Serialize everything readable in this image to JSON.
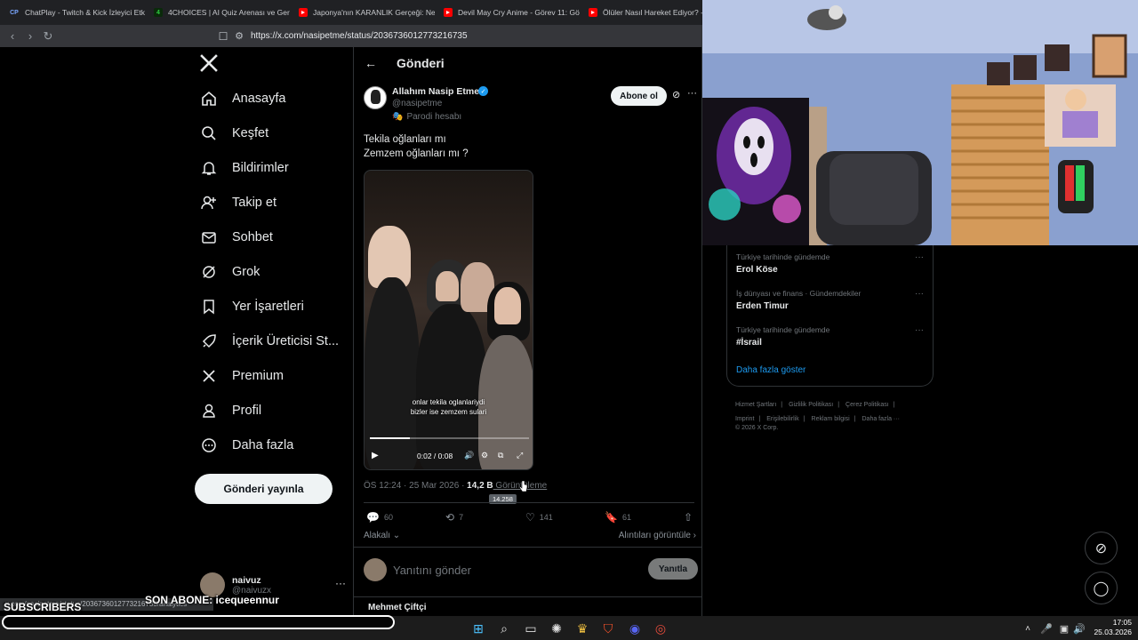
{
  "browser": {
    "tabs": [
      {
        "title": "ChatPlay - Twitch & Kick İzleyici Etkil",
        "favicon": "chatplay-icon"
      },
      {
        "title": "4CHOICES | AI Quiz Arenası ve Gerçe",
        "favicon": "4choices-icon"
      },
      {
        "title": "Japonya'nın KARANLIK Gerçeği: Nedi",
        "favicon": "youtube-icon"
      },
      {
        "title": "Devil May Cry Anime - Görev 11: Gö",
        "favicon": "youtube-icon"
      },
      {
        "title": "Ölüler Nasıl Hareket Ediyor? - Y",
        "favicon": "youtube-icon"
      }
    ],
    "url": "https://x.com/nasipetme/status/2036736012773216735"
  },
  "nav": {
    "items": [
      {
        "label": "Anasayfa",
        "icon": "home-icon"
      },
      {
        "label": "Keşfet",
        "icon": "search-icon"
      },
      {
        "label": "Bildirimler",
        "icon": "bell-icon"
      },
      {
        "label": "Takip et",
        "icon": "person-add-icon"
      },
      {
        "label": "Sohbet",
        "icon": "mail-icon"
      },
      {
        "label": "Grok",
        "icon": "grok-icon"
      },
      {
        "label": "Yer İşaretleri",
        "icon": "bookmark-icon"
      },
      {
        "label": "İçerik Üreticisi St...",
        "icon": "rocket-icon"
      },
      {
        "label": "Premium",
        "icon": "x-icon"
      },
      {
        "label": "Profil",
        "icon": "person-icon"
      },
      {
        "label": "Daha fazla",
        "icon": "more-circle-icon"
      }
    ],
    "post_button": "Gönderi yayınla",
    "user": {
      "name": "naivuz",
      "handle": "@naivuzx"
    }
  },
  "post": {
    "header_title": "Gönderi",
    "author_name": "Allahım Nasip Etme",
    "author_handle": "@nasipetme",
    "parody_label": "Parodi hesabı",
    "follow_button": "Abone ol",
    "text_line1": "Tekila oğlanları mı",
    "text_line2": "Zemzem oğlanları mı ?",
    "video": {
      "caption_line1": "onlar tekila oglanlariydi",
      "caption_line2": "bizler ise zemzem sulari",
      "time": "0:02 / 0:08",
      "progress": 0.25
    },
    "timestamp": "ÖS 12:24 · 25 Mar 2026 · ",
    "views": "14,2 B",
    "views_label": " Görüntüleme",
    "views_tooltip": "14.258",
    "actions": {
      "replies": "60",
      "reposts": "7",
      "likes": "141",
      "bookmarks": "61"
    },
    "sort_label": "Alakalı",
    "quotes_link": "Alıntıları görüntüle",
    "reply_placeholder": "Yanıtını gönder",
    "reply_button": "Yanıtla",
    "next_reply_author": "Mehmet Çiftçi"
  },
  "trends": [
    {
      "context": "Türkiye tarihinde gündemde",
      "name": "Erol Köse"
    },
    {
      "context": "İş dünyası ve finans · Gündemdekiler",
      "name": "Erden Timur"
    },
    {
      "context": "Türkiye tarihinde gündemde",
      "name": "#İsrail"
    }
  ],
  "show_more": "Daha fazla göster",
  "footer": {
    "links": [
      "Hizmet Şartları",
      "|",
      "Gizlilik Politikası",
      "|",
      "Çerez Politikası",
      "|",
      "Imprint",
      "|",
      "Erişilebilirlik",
      "|",
      "Reklam bilgisi",
      "|",
      "Daha fazla ···"
    ],
    "copyright": "© 2026 X Corp."
  },
  "overlay": {
    "status_url": "x.com/nasipetme/status/2036736012773216735/analytics",
    "subscribers_label": "SUBSCRIBERS",
    "last_sub": "SON ABONE: icequeennur"
  },
  "taskbar": {
    "time": "17:05",
    "date": "25.03.2026"
  }
}
